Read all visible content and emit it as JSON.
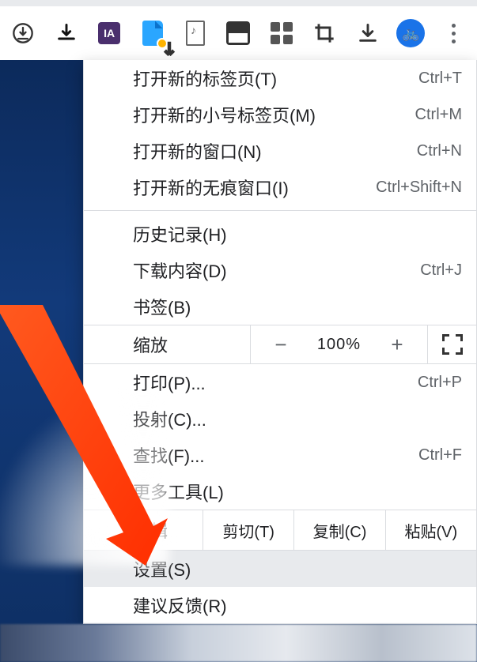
{
  "toolbar": {
    "icons": {
      "download_circle": "下载",
      "download_tray": "下载到",
      "ia": "IA",
      "save_page": "保存页面",
      "music_note": "媒体",
      "picture": "图片",
      "apps": "应用",
      "crop": "截图",
      "download_arrow": "下载",
      "profile": "用户",
      "menu": "菜单"
    }
  },
  "menu": {
    "new_tab": {
      "label": "打开新的标签页(T)",
      "shortcut": "Ctrl+T"
    },
    "new_small_tab": {
      "label": "打开新的小号标签页(M)",
      "shortcut": "Ctrl+M"
    },
    "new_window": {
      "label": "打开新的窗口(N)",
      "shortcut": "Ctrl+N"
    },
    "incognito": {
      "label": "打开新的无痕窗口(I)",
      "shortcut": "Ctrl+Shift+N"
    },
    "history": {
      "label": "历史记录(H)"
    },
    "downloads": {
      "label": "下载内容(D)",
      "shortcut": "Ctrl+J"
    },
    "bookmarks": {
      "label": "书签(B)"
    },
    "zoom": {
      "label": "缩放",
      "minus": "−",
      "pct": "100%",
      "plus": "+"
    },
    "print": {
      "label": "打印(P)...",
      "shortcut": "Ctrl+P"
    },
    "cast": {
      "label": "投射(C)..."
    },
    "find": {
      "label": "查找(F)...",
      "shortcut": "Ctrl+F"
    },
    "more_tools": {
      "label": "更多工具(L)"
    },
    "edit": {
      "label": "编辑",
      "cut": "剪切(T)",
      "copy": "复制(C)",
      "paste": "粘贴(V)"
    },
    "settings": {
      "label": "设置(S)"
    },
    "feedback": {
      "label": "建议反馈(R)"
    }
  }
}
